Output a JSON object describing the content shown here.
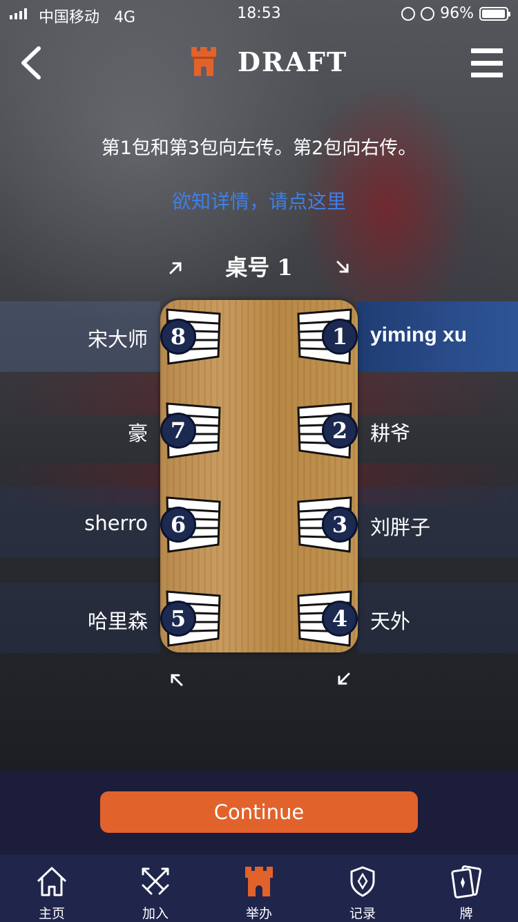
{
  "status_bar": {
    "carrier": "中国移动",
    "network": "4G",
    "time": "18:53",
    "battery": "96%",
    "battery_level": 0.96
  },
  "header": {
    "title": "DRAFT",
    "icons": {
      "back": "chevron-left-icon",
      "logo": "castle-tower-icon",
      "menu": "hamburger-menu-icon"
    },
    "accent_color": "#e2622c"
  },
  "info": {
    "rule_text": "第1包和第3包向左传。第2包向右传。",
    "link_text": "欲知详情，请点这里",
    "link_color": "#3f7fe6"
  },
  "table": {
    "label": "桌号 1",
    "seats": [
      {
        "number": "1",
        "name": "yiming xu",
        "side": "right",
        "current_user": true
      },
      {
        "number": "2",
        "name": "耕爷",
        "side": "right"
      },
      {
        "number": "3",
        "name": "刘胖子",
        "side": "right"
      },
      {
        "number": "4",
        "name": "天外",
        "side": "right"
      },
      {
        "number": "5",
        "name": "哈里森",
        "side": "left"
      },
      {
        "number": "6",
        "name": "sherro",
        "side": "left"
      },
      {
        "number": "7",
        "name": "豪",
        "side": "left"
      },
      {
        "number": "8",
        "name": "宋大师",
        "side": "left"
      }
    ]
  },
  "continue_button": {
    "label": "Continue",
    "color": "#e2622c"
  },
  "tab_bar": {
    "tabs": [
      {
        "label": "主页",
        "icon": "home-icon",
        "active": false
      },
      {
        "label": "加入",
        "icon": "crossed-swords-icon",
        "active": false
      },
      {
        "label": "举办",
        "icon": "castle-tower-icon",
        "active": true
      },
      {
        "label": "记录",
        "icon": "shield-icon",
        "active": false
      },
      {
        "label": "牌",
        "icon": "cards-icon",
        "active": false
      }
    ]
  }
}
